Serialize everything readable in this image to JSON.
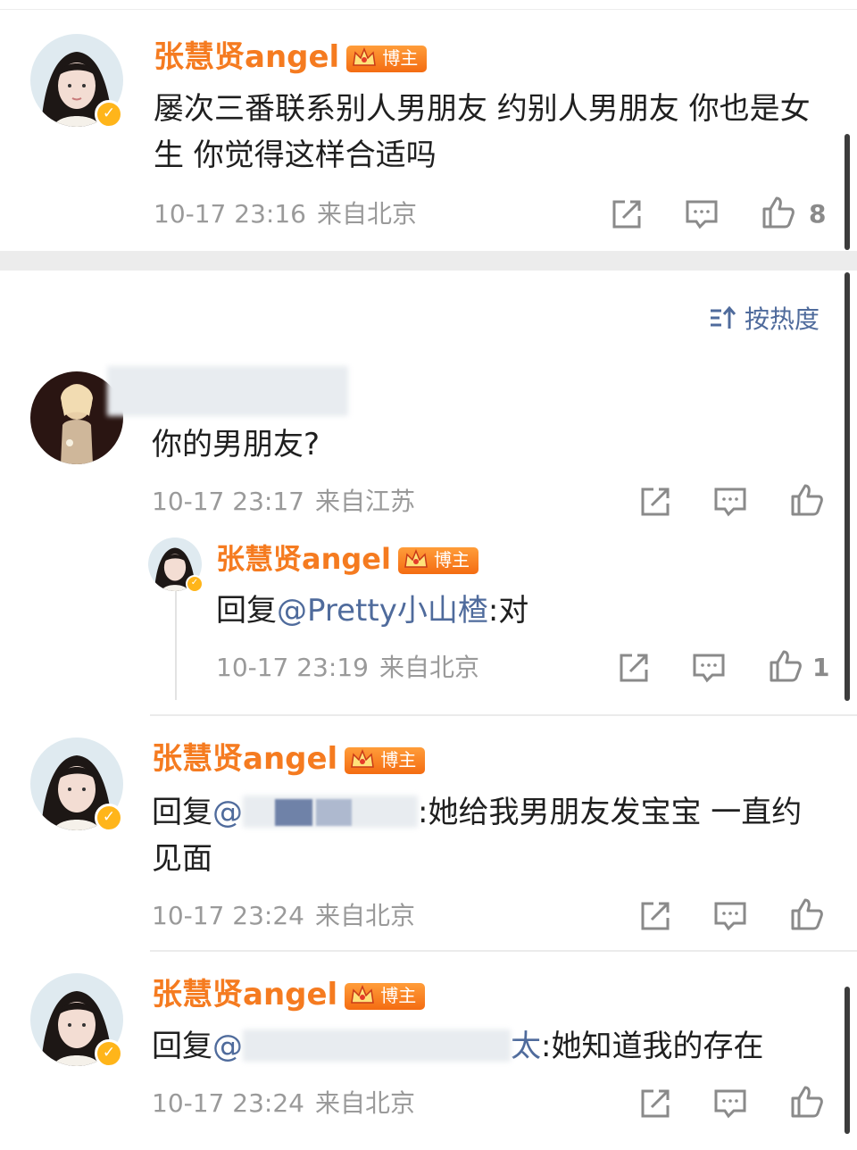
{
  "comments": [
    {
      "author": "张慧贤angel",
      "tag": "博主",
      "text": "屡次三番联系别人男朋友 约别人男朋友 你也是女生 你觉得这样合适吗",
      "time": "10-17 23:16",
      "location": "来自北京",
      "likes": "8"
    }
  ],
  "sort_label": "按热度",
  "thread": [
    {
      "text": "你的男朋友?",
      "time": "10-17 23:17",
      "location": "来自江苏"
    },
    {
      "author": "张慧贤angel",
      "tag": "博主",
      "reply_prefix": "回复",
      "mention": "@Pretty小山楂",
      "reply_text": ":对",
      "time": "10-17 23:19",
      "location": "来自北京",
      "likes": "1"
    },
    {
      "author": "张慧贤angel",
      "tag": "博主",
      "reply_prefix": "回复",
      "mention_visible_start": "@",
      "reply_text": ":她给我男朋友发宝宝 一直约见面",
      "time": "10-17 23:24",
      "location": "来自北京"
    },
    {
      "author": "张慧贤angel",
      "tag": "博主",
      "reply_prefix": "回复",
      "mention_visible_start": "@",
      "mention_visible_end": "太",
      "reply_text": ":她知道我的存在",
      "time": "10-17 23:24",
      "location": "来自北京"
    }
  ],
  "colors": {
    "author": "#f57b20",
    "mention": "#4f6b9c",
    "meta": "#9a9a9a",
    "badge": "#ffb51a"
  },
  "icons": [
    "share-icon",
    "comment-icon",
    "like-icon",
    "sort-icon",
    "crown-icon",
    "verified-icon"
  ]
}
